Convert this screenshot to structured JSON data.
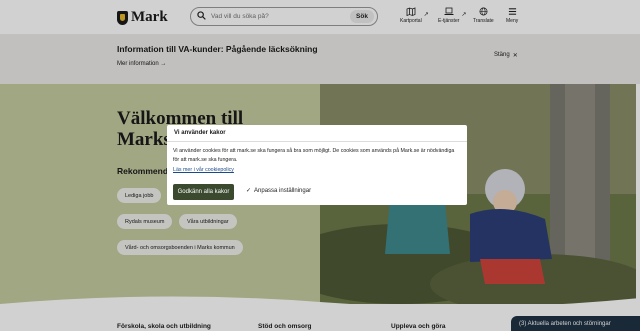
{
  "header": {
    "logo_text": "Mark",
    "search_placeholder": "Vad vill du söka på?",
    "search_button": "Sök",
    "tools": [
      {
        "label": "Kartportal",
        "icon": "map-icon"
      },
      {
        "label": "E-tjänster",
        "icon": "laptop-icon"
      },
      {
        "label": "Translate",
        "icon": "globe-icon"
      },
      {
        "label": "Meny",
        "icon": "hamburger-icon"
      }
    ]
  },
  "banner": {
    "title": "Information till VA-kunder: Pågående läcksökning",
    "more_link": "Mer information",
    "close_label": "Stäng"
  },
  "hero": {
    "title": "Välkommen till Marks kommun",
    "recommended_heading": "Rekommenderat",
    "pills": [
      "Lediga jobb",
      "Rydals museum",
      "Våra utbildningar",
      "Vård- och omsorgsboenden i Marks kommun"
    ]
  },
  "bottom_links": [
    "Förskola, skola och utbildning",
    "Stöd och omsorg",
    "Uppleva och göra"
  ],
  "status_button": "(3) Aktuella arbeten och störningar",
  "cookie_dialog": {
    "title": "Vi använder kakor",
    "text": "Vi använder cookies för att mark.se ska fungera så bra som möjligt. De cookies som används på Mark.se är nödvändiga för att mark.se ska fungera.",
    "policy_link": "Läs mer i vår cookiepolicy",
    "accept_button": "Godkänn alla kakor",
    "customize_button": "Anpassa inställningar"
  },
  "colors": {
    "hero_green": "#c5cba0",
    "banner_bg": "#ecebe8",
    "accept_button": "#3b4a2f",
    "status_button": "#1f3244"
  }
}
